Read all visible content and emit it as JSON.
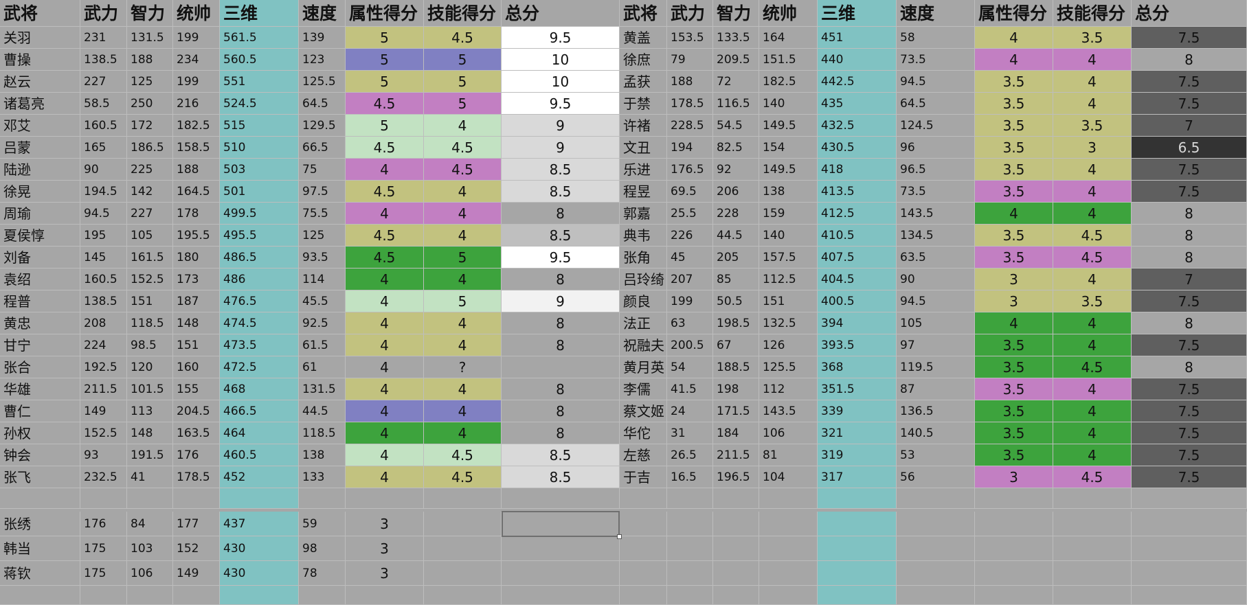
{
  "colors": {
    "cyan": "#80c2c2",
    "yellow": "#c2c27f",
    "blue": "#8080c2",
    "magenta": "#c27fc2",
    "light_green": "#c2e2c2",
    "green": "#3da33d",
    "white": "#ffffff",
    "very_light_gray": "#f2f2f2",
    "light_gray": "#d9d9d9",
    "silver": "#bfbfbf",
    "gray": "#a6a6a6",
    "dark_gray": "#5f5f5f",
    "charcoal": "#333333"
  },
  "headers": [
    "武将",
    "武力",
    "智力",
    "统帅",
    "三维",
    "速度",
    "属性得分",
    "技能得分",
    "总分"
  ],
  "left_table": [
    {
      "name": "关羽",
      "wu": "231",
      "zhi": "131.5",
      "tong": "199",
      "sanwei": "561.5",
      "speed": "139",
      "attr": "5",
      "skill": "4.5",
      "total": "9.5",
      "attr_bg": "yellow",
      "skill_bg": "yellow",
      "total_bg": "white"
    },
    {
      "name": "曹操",
      "wu": "138.5",
      "zhi": "188",
      "tong": "234",
      "sanwei": "560.5",
      "speed": "123",
      "attr": "5",
      "skill": "5",
      "total": "10",
      "attr_bg": "blue",
      "skill_bg": "blue",
      "total_bg": "white"
    },
    {
      "name": "赵云",
      "wu": "227",
      "zhi": "125",
      "tong": "199",
      "sanwei": "551",
      "speed": "125.5",
      "attr": "5",
      "skill": "5",
      "total": "10",
      "attr_bg": "yellow",
      "skill_bg": "yellow",
      "total_bg": "white"
    },
    {
      "name": "诸葛亮",
      "wu": "58.5",
      "zhi": "250",
      "tong": "216",
      "sanwei": "524.5",
      "speed": "64.5",
      "attr": "4.5",
      "skill": "5",
      "total": "9.5",
      "attr_bg": "magenta",
      "skill_bg": "magenta",
      "total_bg": "white"
    },
    {
      "name": "邓艾",
      "wu": "160.5",
      "zhi": "172",
      "tong": "182.5",
      "sanwei": "515",
      "speed": "129.5",
      "attr": "5",
      "skill": "4",
      "total": "9",
      "attr_bg": "light_green",
      "skill_bg": "light_green",
      "total_bg": "light_gray"
    },
    {
      "name": "吕蒙",
      "wu": "165",
      "zhi": "186.5",
      "tong": "158.5",
      "sanwei": "510",
      "speed": "66.5",
      "attr": "4.5",
      "skill": "4.5",
      "total": "9",
      "attr_bg": "light_green",
      "skill_bg": "light_green",
      "total_bg": "light_gray"
    },
    {
      "name": "陆逊",
      "wu": "90",
      "zhi": "225",
      "tong": "188",
      "sanwei": "503",
      "speed": "75",
      "attr": "4",
      "skill": "4.5",
      "total": "8.5",
      "attr_bg": "magenta",
      "skill_bg": "magenta",
      "total_bg": "light_gray"
    },
    {
      "name": "徐晃",
      "wu": "194.5",
      "zhi": "142",
      "tong": "164.5",
      "sanwei": "501",
      "speed": "97.5",
      "attr": "4.5",
      "skill": "4",
      "total": "8.5",
      "attr_bg": "yellow",
      "skill_bg": "yellow",
      "total_bg": "light_gray"
    },
    {
      "name": "周瑜",
      "wu": "94.5",
      "zhi": "227",
      "tong": "178",
      "sanwei": "499.5",
      "speed": "75.5",
      "attr": "4",
      "skill": "4",
      "total": "8",
      "attr_bg": "magenta",
      "skill_bg": "magenta",
      "total_bg": "gray"
    },
    {
      "name": "夏侯惇",
      "wu": "195",
      "zhi": "105",
      "tong": "195.5",
      "sanwei": "495.5",
      "speed": "125",
      "attr": "4.5",
      "skill": "4",
      "total": "8.5",
      "attr_bg": "yellow",
      "skill_bg": "yellow",
      "total_bg": "silver"
    },
    {
      "name": "刘备",
      "wu": "145",
      "zhi": "161.5",
      "tong": "180",
      "sanwei": "486.5",
      "speed": "93.5",
      "attr": "4.5",
      "skill": "5",
      "total": "9.5",
      "attr_bg": "green",
      "skill_bg": "green",
      "total_bg": "white"
    },
    {
      "name": "袁绍",
      "wu": "160.5",
      "zhi": "152.5",
      "tong": "173",
      "sanwei": "486",
      "speed": "114",
      "attr": "4",
      "skill": "4",
      "total": "8",
      "attr_bg": "green",
      "skill_bg": "green",
      "total_bg": "gray"
    },
    {
      "name": "程普",
      "wu": "138.5",
      "zhi": "151",
      "tong": "187",
      "sanwei": "476.5",
      "speed": "45.5",
      "attr": "4",
      "skill": "5",
      "total": "9",
      "attr_bg": "light_green",
      "skill_bg": "light_green",
      "total_bg": "very_light_gray"
    },
    {
      "name": "黄忠",
      "wu": "208",
      "zhi": "118.5",
      "tong": "148",
      "sanwei": "474.5",
      "speed": "92.5",
      "attr": "4",
      "skill": "4",
      "total": "8",
      "attr_bg": "yellow",
      "skill_bg": "yellow",
      "total_bg": "gray"
    },
    {
      "name": "甘宁",
      "wu": "224",
      "zhi": "98.5",
      "tong": "151",
      "sanwei": "473.5",
      "speed": "61.5",
      "attr": "4",
      "skill": "4",
      "total": "8",
      "attr_bg": "yellow",
      "skill_bg": "yellow",
      "total_bg": "gray"
    },
    {
      "name": "张合",
      "wu": "192.5",
      "zhi": "120",
      "tong": "160",
      "sanwei": "472.5",
      "speed": "61",
      "attr": "4",
      "skill": "?",
      "total": "",
      "attr_bg": "gray",
      "skill_bg": "gray",
      "total_bg": "gray"
    },
    {
      "name": "华雄",
      "wu": "211.5",
      "zhi": "101.5",
      "tong": "155",
      "sanwei": "468",
      "speed": "131.5",
      "attr": "4",
      "skill": "4",
      "total": "8",
      "attr_bg": "yellow",
      "skill_bg": "yellow",
      "total_bg": "gray"
    },
    {
      "name": "曹仁",
      "wu": "149",
      "zhi": "113",
      "tong": "204.5",
      "sanwei": "466.5",
      "speed": "44.5",
      "attr": "4",
      "skill": "4",
      "total": "8",
      "attr_bg": "blue",
      "skill_bg": "blue",
      "total_bg": "gray"
    },
    {
      "name": "孙权",
      "wu": "152.5",
      "zhi": "148",
      "tong": "163.5",
      "sanwei": "464",
      "speed": "118.5",
      "attr": "4",
      "skill": "4",
      "total": "8",
      "attr_bg": "green",
      "skill_bg": "green",
      "total_bg": "gray"
    },
    {
      "name": "钟会",
      "wu": "93",
      "zhi": "191.5",
      "tong": "176",
      "sanwei": "460.5",
      "speed": "138",
      "attr": "4",
      "skill": "4.5",
      "total": "8.5",
      "attr_bg": "light_green",
      "skill_bg": "light_green",
      "total_bg": "light_gray"
    },
    {
      "name": "张飞",
      "wu": "232.5",
      "zhi": "41",
      "tong": "178.5",
      "sanwei": "452",
      "speed": "133",
      "attr": "4",
      "skill": "4.5",
      "total": "8.5",
      "attr_bg": "yellow",
      "skill_bg": "yellow",
      "total_bg": "light_gray"
    }
  ],
  "right_table": [
    {
      "name": "黄盖",
      "wu": "153.5",
      "zhi": "133.5",
      "tong": "164",
      "sanwei": "451",
      "speed": "58",
      "attr": "4",
      "skill": "3.5",
      "total": "7.5",
      "attr_bg": "yellow",
      "skill_bg": "yellow",
      "total_bg": "dark_gray"
    },
    {
      "name": "徐庶",
      "wu": "79",
      "zhi": "209.5",
      "tong": "151.5",
      "sanwei": "440",
      "speed": "73.5",
      "attr": "4",
      "skill": "4",
      "total": "8",
      "attr_bg": "magenta",
      "skill_bg": "magenta",
      "total_bg": "gray"
    },
    {
      "name": "孟获",
      "wu": "188",
      "zhi": "72",
      "tong": "182.5",
      "sanwei": "442.5",
      "speed": "94.5",
      "attr": "3.5",
      "skill": "4",
      "total": "7.5",
      "attr_bg": "yellow",
      "skill_bg": "yellow",
      "total_bg": "dark_gray"
    },
    {
      "name": "于禁",
      "wu": "178.5",
      "zhi": "116.5",
      "tong": "140",
      "sanwei": "435",
      "speed": "64.5",
      "attr": "3.5",
      "skill": "4",
      "total": "7.5",
      "attr_bg": "yellow",
      "skill_bg": "yellow",
      "total_bg": "dark_gray"
    },
    {
      "name": "许褚",
      "wu": "228.5",
      "zhi": "54.5",
      "tong": "149.5",
      "sanwei": "432.5",
      "speed": "124.5",
      "attr": "3.5",
      "skill": "3.5",
      "total": "7",
      "attr_bg": "yellow",
      "skill_bg": "yellow",
      "total_bg": "dark_gray"
    },
    {
      "name": "文丑",
      "wu": "194",
      "zhi": "82.5",
      "tong": "154",
      "sanwei": "430.5",
      "speed": "96",
      "attr": "3.5",
      "skill": "3",
      "total": "6.5",
      "attr_bg": "yellow",
      "skill_bg": "yellow",
      "total_bg": "charcoal"
    },
    {
      "name": "乐进",
      "wu": "176.5",
      "zhi": "92",
      "tong": "149.5",
      "sanwei": "418",
      "speed": "96.5",
      "attr": "3.5",
      "skill": "4",
      "total": "7.5",
      "attr_bg": "yellow",
      "skill_bg": "yellow",
      "total_bg": "dark_gray"
    },
    {
      "name": "程昱",
      "wu": "69.5",
      "zhi": "206",
      "tong": "138",
      "sanwei": "413.5",
      "speed": "73.5",
      "attr": "3.5",
      "skill": "4",
      "total": "7.5",
      "attr_bg": "magenta",
      "skill_bg": "magenta",
      "total_bg": "dark_gray"
    },
    {
      "name": "郭嘉",
      "wu": "25.5",
      "zhi": "228",
      "tong": "159",
      "sanwei": "412.5",
      "speed": "143.5",
      "attr": "4",
      "skill": "4",
      "total": "8",
      "attr_bg": "green",
      "skill_bg": "green",
      "total_bg": "gray"
    },
    {
      "name": "典韦",
      "wu": "226",
      "zhi": "44.5",
      "tong": "140",
      "sanwei": "410.5",
      "speed": "134.5",
      "attr": "3.5",
      "skill": "4.5",
      "total": "8",
      "attr_bg": "yellow",
      "skill_bg": "yellow",
      "total_bg": "gray"
    },
    {
      "name": "张角",
      "wu": "45",
      "zhi": "205",
      "tong": "157.5",
      "sanwei": "407.5",
      "speed": "63.5",
      "attr": "3.5",
      "skill": "4.5",
      "total": "8",
      "attr_bg": "magenta",
      "skill_bg": "magenta",
      "total_bg": "gray"
    },
    {
      "name": "吕玲绮",
      "wu": "207",
      "zhi": "85",
      "tong": "112.5",
      "sanwei": "404.5",
      "speed": "90",
      "attr": "3",
      "skill": "4",
      "total": "7",
      "attr_bg": "yellow",
      "skill_bg": "yellow",
      "total_bg": "dark_gray"
    },
    {
      "name": "颜良",
      "wu": "199",
      "zhi": "50.5",
      "tong": "151",
      "sanwei": "400.5",
      "speed": "94.5",
      "attr": "3",
      "skill": "3.5",
      "total": "7.5",
      "attr_bg": "yellow",
      "skill_bg": "yellow",
      "total_bg": "dark_gray"
    },
    {
      "name": "法正",
      "wu": "63",
      "zhi": "198.5",
      "tong": "132.5",
      "sanwei": "394",
      "speed": "105",
      "attr": "4",
      "skill": "4",
      "total": "8",
      "attr_bg": "green",
      "skill_bg": "green",
      "total_bg": "gray"
    },
    {
      "name": "祝融夫",
      "wu": "200.5",
      "zhi": "67",
      "tong": "126",
      "sanwei": "393.5",
      "speed": "97",
      "attr": "3.5",
      "skill": "4",
      "total": "7.5",
      "attr_bg": "green",
      "skill_bg": "green",
      "total_bg": "dark_gray"
    },
    {
      "name": "黄月英",
      "wu": "54",
      "zhi": "188.5",
      "tong": "125.5",
      "sanwei": "368",
      "speed": "119.5",
      "attr": "3.5",
      "skill": "4.5",
      "total": "8",
      "attr_bg": "green",
      "skill_bg": "green",
      "total_bg": "gray"
    },
    {
      "name": "李儒",
      "wu": "41.5",
      "zhi": "198",
      "tong": "112",
      "sanwei": "351.5",
      "speed": "87",
      "attr": "3.5",
      "skill": "4",
      "total": "7.5",
      "attr_bg": "magenta",
      "skill_bg": "magenta",
      "total_bg": "dark_gray"
    },
    {
      "name": "蔡文姬",
      "wu": "24",
      "zhi": "171.5",
      "tong": "143.5",
      "sanwei": "339",
      "speed": "136.5",
      "attr": "3.5",
      "skill": "4",
      "total": "7.5",
      "attr_bg": "green",
      "skill_bg": "green",
      "total_bg": "dark_gray"
    },
    {
      "name": "华佗",
      "wu": "31",
      "zhi": "184",
      "tong": "106",
      "sanwei": "321",
      "speed": "140.5",
      "attr": "3.5",
      "skill": "4",
      "total": "7.5",
      "attr_bg": "green",
      "skill_bg": "green",
      "total_bg": "dark_gray"
    },
    {
      "name": "左慈",
      "wu": "26.5",
      "zhi": "211.5",
      "tong": "81",
      "sanwei": "319",
      "speed": "53",
      "attr": "3.5",
      "skill": "4",
      "total": "7.5",
      "attr_bg": "green",
      "skill_bg": "green",
      "total_bg": "dark_gray"
    },
    {
      "name": "于吉",
      "wu": "16.5",
      "zhi": "196.5",
      "tong": "104",
      "sanwei": "317",
      "speed": "56",
      "attr": "3",
      "skill": "4.5",
      "total": "7.5",
      "attr_bg": "magenta",
      "skill_bg": "magenta",
      "total_bg": "dark_gray"
    }
  ],
  "extra_rows": [
    {
      "name": "张绣",
      "wu": "176",
      "zhi": "84",
      "tong": "177",
      "sanwei": "437",
      "speed": "59",
      "attr": "3"
    },
    {
      "name": "韩当",
      "wu": "175",
      "zhi": "103",
      "tong": "152",
      "sanwei": "430",
      "speed": "98",
      "attr": "3"
    },
    {
      "name": "蒋钦",
      "wu": "175",
      "zhi": "106",
      "tong": "149",
      "sanwei": "430",
      "speed": "78",
      "attr": "3"
    }
  ]
}
